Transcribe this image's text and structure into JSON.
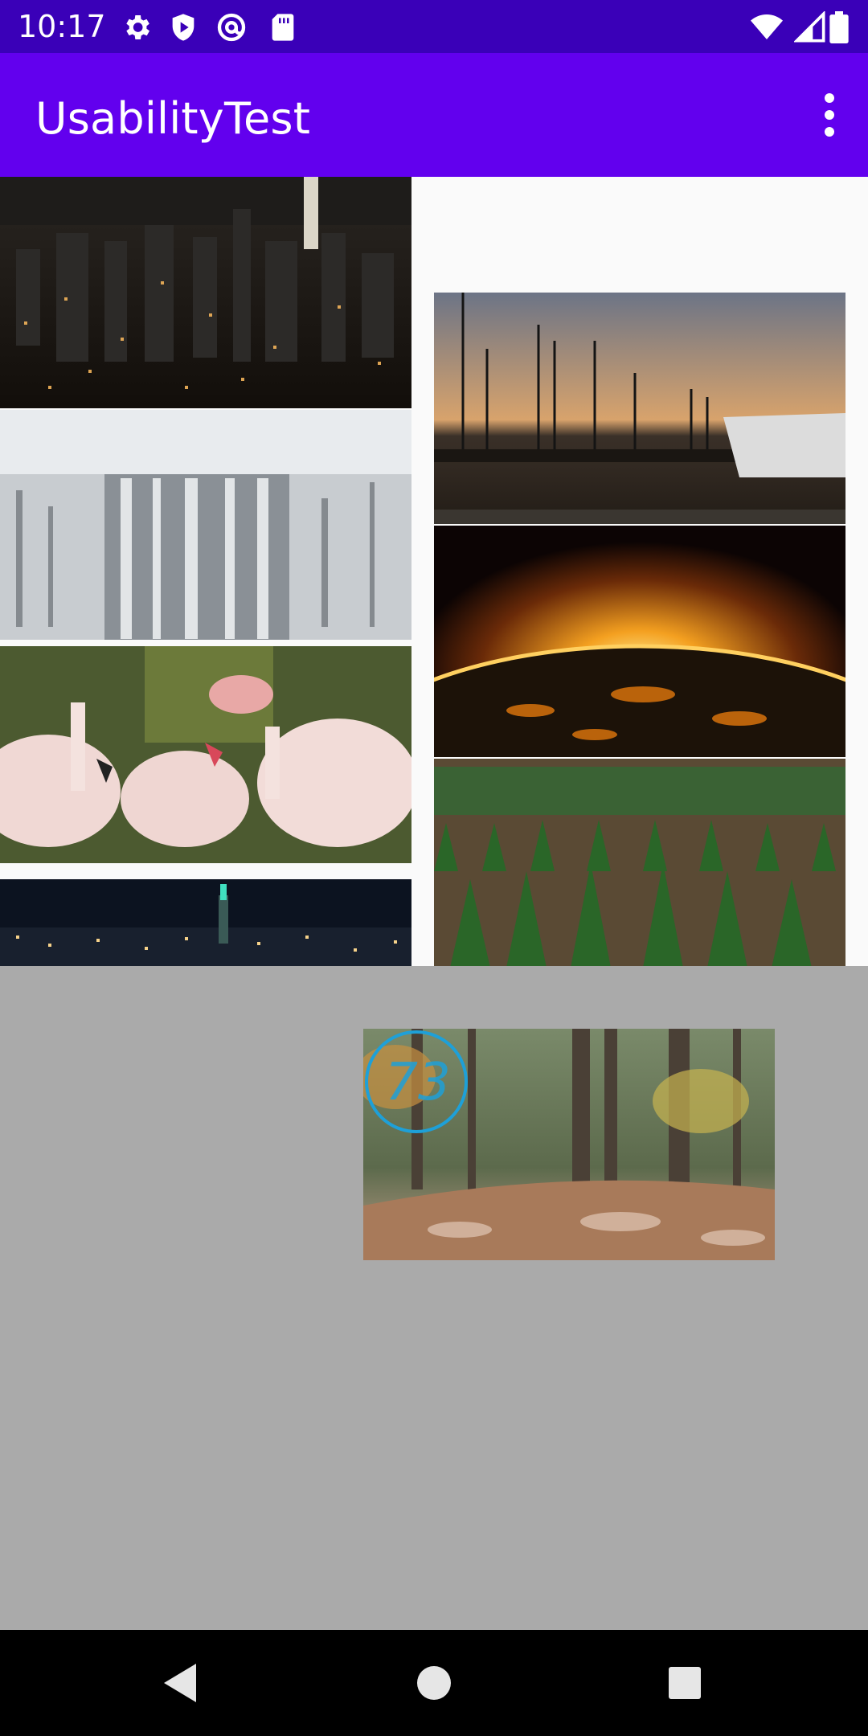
{
  "status_bar": {
    "time": "10:17",
    "left_icons": [
      "settings-icon",
      "shield-icon",
      "at-sign-icon",
      "sd-card-icon"
    ],
    "right_icons": [
      "wifi-icon",
      "signal-icon",
      "battery-icon"
    ]
  },
  "app_bar": {
    "title": "UsabilityTest",
    "menu_icon": "more-vert-icon",
    "color": "#6200ee"
  },
  "gallery": {
    "left_column": [
      {
        "name": "city-night-skyline"
      },
      {
        "name": "frozen-waterfall"
      },
      {
        "name": "flamingos"
      },
      {
        "name": "city-night-panorama"
      }
    ],
    "right_column": [
      {
        "name": "marina-sunset"
      },
      {
        "name": "planet-sunrise-space"
      },
      {
        "name": "pine-tree-farm"
      }
    ]
  },
  "overlay": {
    "video": {
      "name": "autumn-forest-leaves"
    },
    "timer_value": "73",
    "timer_color": "#1ea0d8"
  },
  "nav_bar": {
    "buttons": [
      "back-icon",
      "home-icon",
      "recents-icon"
    ]
  }
}
